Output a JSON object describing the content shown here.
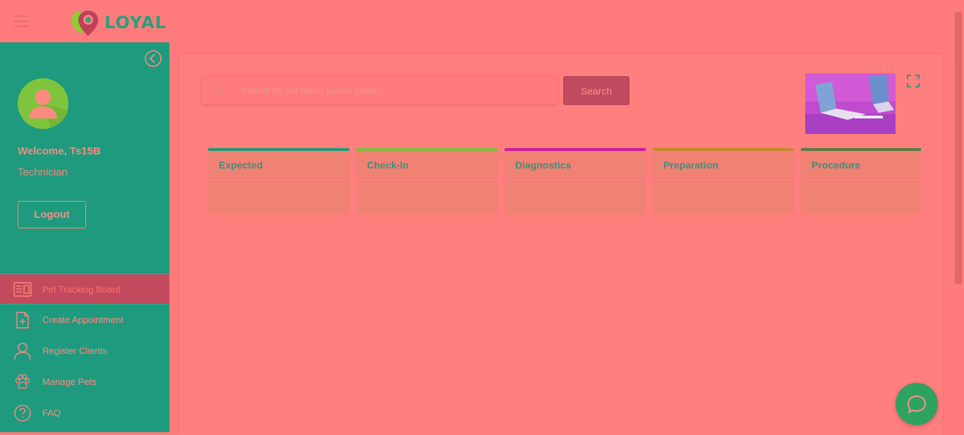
{
  "header": {
    "brand": "LOYAL"
  },
  "user": {
    "welcome": "Welcome, Ts15B",
    "role": "Technician",
    "logout_label": "Logout"
  },
  "nav": {
    "items": [
      {
        "label": "Pet Tracking Board",
        "icon": "board-icon",
        "active": true
      },
      {
        "label": "Create Appointment",
        "icon": "add-file-icon"
      },
      {
        "label": "Register Clients",
        "icon": "user-icon"
      },
      {
        "label": "Manage Pets",
        "icon": "paw-icon"
      },
      {
        "label": "FAQ",
        "icon": "question-icon"
      }
    ]
  },
  "search": {
    "placeholder": "Search by pet name parent name...",
    "button_label": "Search"
  },
  "board": {
    "columns": [
      {
        "title": "Expected",
        "color": "#1e9a78"
      },
      {
        "title": "Check-In",
        "color": "#7fbf3a"
      },
      {
        "title": "Diagnostics",
        "color": "#d11aa3"
      },
      {
        "title": "Preparation",
        "color": "#c58a2c"
      },
      {
        "title": "Procedure",
        "color": "#5a7a45"
      }
    ]
  },
  "colors": {
    "sidebar": "#1e9a7e",
    "background": "#ff7b7b",
    "accent": "#c04a5e",
    "chat": "#2ea35f"
  }
}
